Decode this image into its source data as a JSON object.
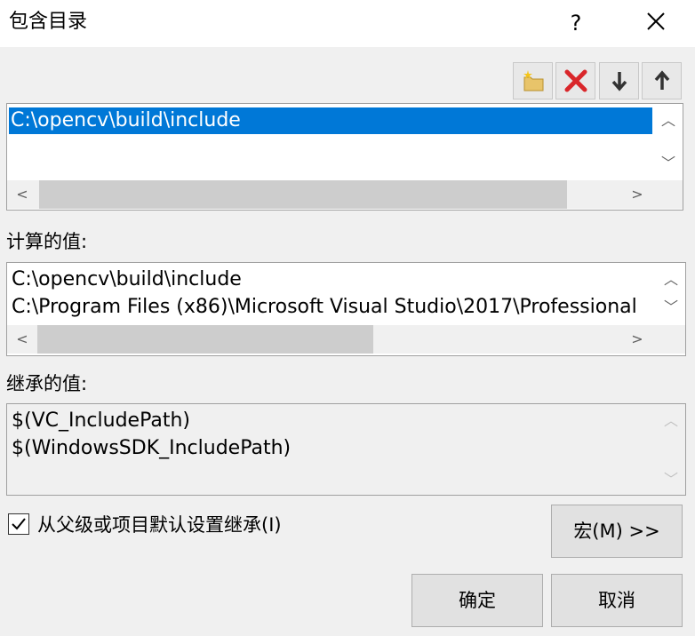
{
  "dialog": {
    "title": "包含目录",
    "help_label": "?"
  },
  "toolbar": {
    "icons": [
      "new-folder-icon",
      "delete-icon",
      "move-down-icon",
      "move-up-icon"
    ]
  },
  "edit_list": {
    "items": [
      "C:\\opencv\\build\\include"
    ],
    "selected_index": 0
  },
  "computed": {
    "label": "计算的值:",
    "lines": [
      "C:\\opencv\\build\\include",
      "C:\\Program Files (x86)\\Microsoft Visual Studio\\2017\\Professional"
    ]
  },
  "inherited": {
    "label": "继承的值:",
    "lines": [
      "$(VC_IncludePath)",
      "$(WindowsSDK_IncludePath)"
    ]
  },
  "inherit_checkbox": {
    "label": "从父级或项目默认设置继承(I)",
    "checked": true
  },
  "buttons": {
    "macros": "宏(M) >>",
    "ok": "确定",
    "cancel": "取消"
  },
  "colors": {
    "selection": "#0078d7",
    "delete_red": "#d9262a"
  }
}
